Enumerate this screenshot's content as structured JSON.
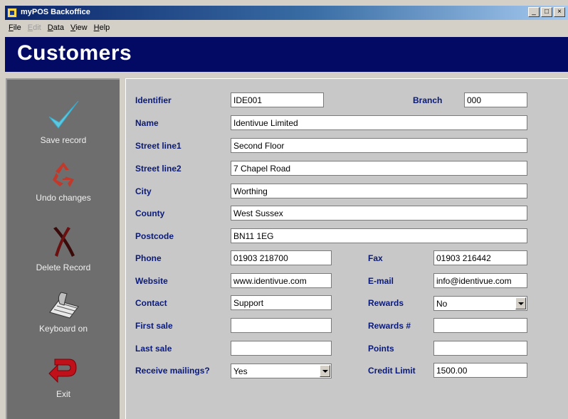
{
  "window": {
    "title": "myPOS Backoffice",
    "min": "_",
    "max": "□",
    "close": "×"
  },
  "menu": [
    {
      "label": "File",
      "enabled": true
    },
    {
      "label": "Edit",
      "enabled": false
    },
    {
      "label": "Data",
      "enabled": true
    },
    {
      "label": "View",
      "enabled": true
    },
    {
      "label": "Help",
      "enabled": true
    }
  ],
  "page": {
    "title": "Customers"
  },
  "sidebar": {
    "save": "Save record",
    "undo": "Undo changes",
    "delete": "Delete Record",
    "keyboard": "Keyboard on",
    "exit": "Exit"
  },
  "form": {
    "identifier": {
      "label": "Identifier",
      "value": "IDE001"
    },
    "branch": {
      "label": "Branch",
      "value": "000"
    },
    "name": {
      "label": "Name",
      "value": "Identivue Limited"
    },
    "street1": {
      "label": "Street line1",
      "value": "Second Floor"
    },
    "street2": {
      "label": "Street line2",
      "value": "7 Chapel Road"
    },
    "city": {
      "label": "City",
      "value": "Worthing"
    },
    "county": {
      "label": "County",
      "value": "West Sussex"
    },
    "postcode": {
      "label": "Postcode",
      "value": "BN11 1EG"
    },
    "phone": {
      "label": "Phone",
      "value": "01903 218700"
    },
    "fax": {
      "label": "Fax",
      "value": "01903 216442"
    },
    "website": {
      "label": "Website",
      "value": "www.identivue.com"
    },
    "email": {
      "label": "E-mail",
      "value": "info@identivue.com"
    },
    "contact": {
      "label": "Contact",
      "value": "Support"
    },
    "rewards": {
      "label": "Rewards",
      "value": "No"
    },
    "first_sale": {
      "label": "First sale",
      "value": ""
    },
    "rewards_no": {
      "label": "Rewards #",
      "value": ""
    },
    "last_sale": {
      "label": "Last sale",
      "value": ""
    },
    "points": {
      "label": "Points",
      "value": ""
    },
    "mailings": {
      "label": "Receive mailings?",
      "value": "Yes"
    },
    "credit_limit": {
      "label": "Credit Limit",
      "value": "1500.00"
    }
  },
  "colors": {
    "header": "#020a64",
    "label": "#0a1a7a",
    "sidebar": "#6e6e6e",
    "panel": "#c8c8c8"
  }
}
